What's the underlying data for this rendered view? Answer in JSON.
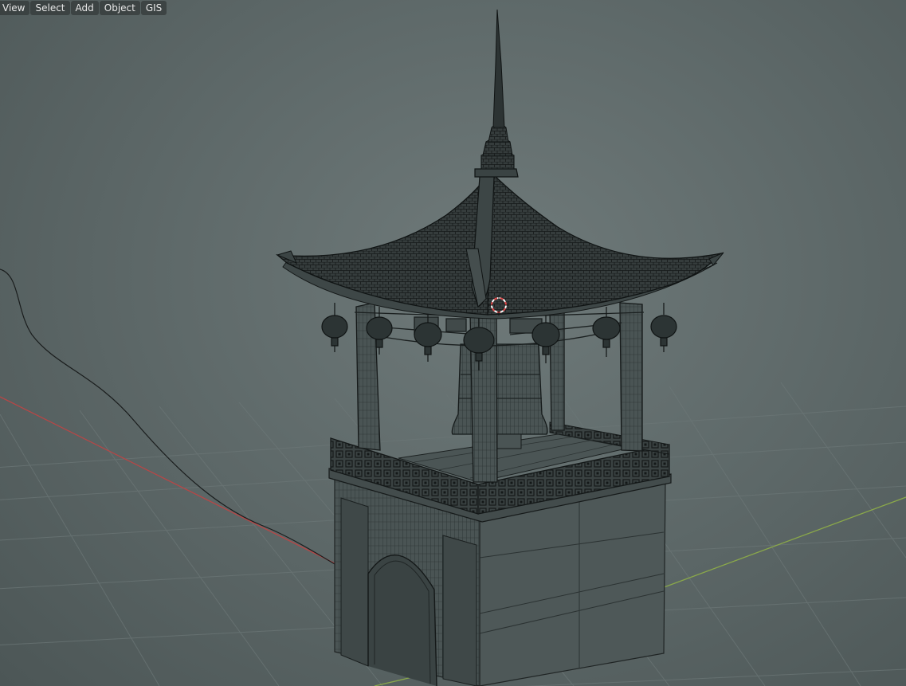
{
  "header_menu": {
    "items": [
      {
        "label": "View"
      },
      {
        "label": "Select"
      },
      {
        "label": "Add"
      },
      {
        "label": "Object"
      },
      {
        "label": "GIS"
      }
    ]
  },
  "viewport": {
    "shading": "wireframe",
    "colors": {
      "background": "#5f6a6a",
      "grid": "#6a7575",
      "x_axis": "#c04545",
      "y_axis": "#8fb049",
      "wire": "#1f2424",
      "mesh_fill": "#4d5757",
      "cursor_red": "#e05050",
      "cursor_white": "#ffffff"
    }
  }
}
